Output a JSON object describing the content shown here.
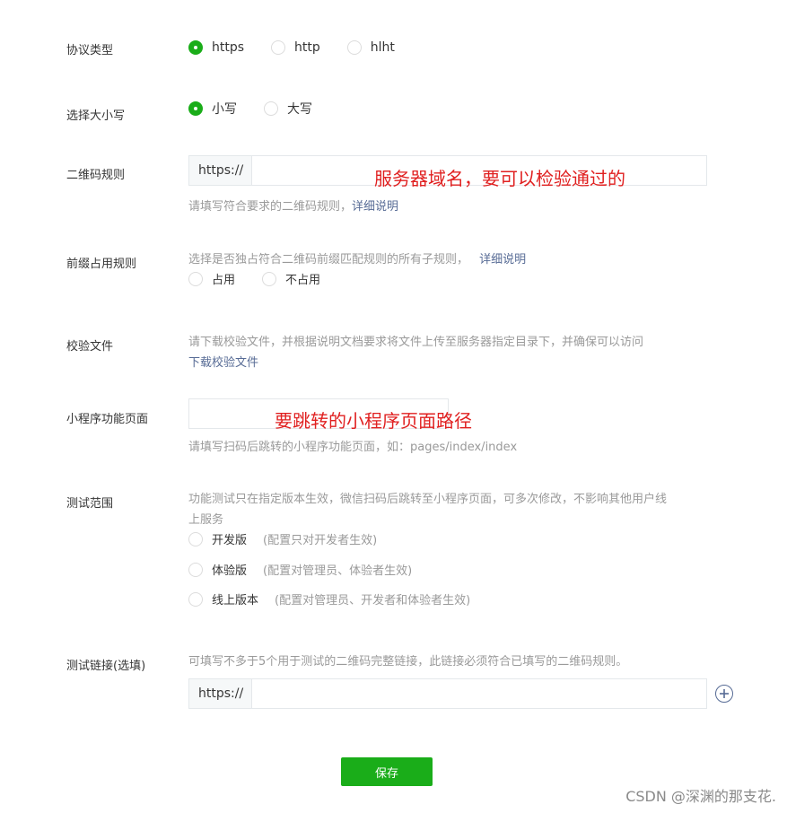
{
  "protocol": {
    "label": "协议类型",
    "options": [
      "https",
      "http",
      "hlht"
    ],
    "selected": "https"
  },
  "case": {
    "label": "选择大小写",
    "options": [
      "小写",
      "大写"
    ],
    "selected": "小写"
  },
  "qr_rule": {
    "label": "二维码规则",
    "prefix": "https://",
    "value": "",
    "annotation": "服务器域名，要可以检验通过的",
    "hint": "请填写符合要求的二维码规则，",
    "hint_link": "详细说明"
  },
  "prefix_rule": {
    "label": "前缀占用规则",
    "hint": "选择是否独占符合二维码前缀匹配规则的所有子规则，",
    "hint_link": "详细说明",
    "options": [
      "占用",
      "不占用"
    ]
  },
  "verify_file": {
    "label": "校验文件",
    "hint": "请下载校验文件，并根据说明文档要求将文件上传至服务器指定目录下，并确保可以访问",
    "download_link": "下载校验文件"
  },
  "page": {
    "label": "小程序功能页面",
    "value": "",
    "annotation": "要跳转的小程序页面路径",
    "hint": "请填写扫码后跳转的小程序功能页面，如：pages/index/index"
  },
  "scope": {
    "label": "测试范围",
    "hint_line1": "功能测试只在指定版本生效，微信扫码后跳转至小程序页面，可多次修改，不影响其他用户线",
    "hint_line2": "上服务",
    "options": [
      {
        "label": "开发版",
        "note": "(配置只对开发者生效)"
      },
      {
        "label": "体验版",
        "note": "(配置对管理员、体验者生效)"
      },
      {
        "label": "线上版本",
        "note": "(配置对管理员、开发者和体验者生效)"
      }
    ]
  },
  "test_link": {
    "label": "测试链接(选填)",
    "hint": "可填写不多于5个用于测试的二维码完整链接，此链接必须符合已填写的二维码规则。",
    "prefix": "https://",
    "value": ""
  },
  "save_label": "保存",
  "watermark": "CSDN @深渊的那支花.",
  "colors": {
    "accent": "#1aad19",
    "link": "#576b95",
    "annotation": "#e02020"
  },
  "icons": {
    "add": "plus-circle-icon"
  }
}
